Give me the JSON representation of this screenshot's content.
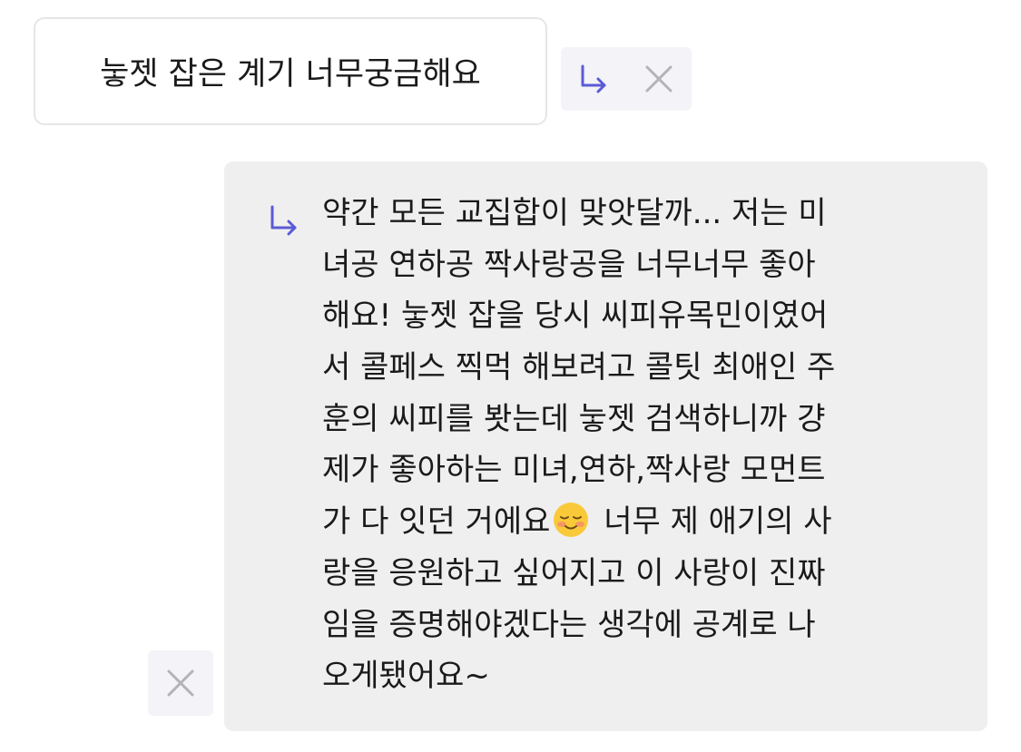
{
  "question": {
    "text": "눟젯 잡은 계기 너무궁금해요"
  },
  "question_actions": {
    "reply_icon": "reply-arrow-icon",
    "close_icon": "close-icon"
  },
  "answer": {
    "reply_icon": "reply-arrow-icon",
    "lines": [
      "약간 모든 교집합이 맞앗달까... 저는 미",
      "녀공 연하공 짝사랑공을 너무너무 좋아",
      "해요! 눟젯 잡을 당시 씨피유목민이였어",
      "서 콜페스 찍먹 해보려고 콜팃 최애인 주",
      "훈의 씨피를 봣는데 눟젯 검색하니까 걍",
      "제가 좋아하는 미녀,연하,짝사랑 모먼트",
      "",
      "랑을 응원하고 싶어지고 이 사랑이 진짜",
      "임을 증명해야겠다는 생각에 공계로 나",
      "오게됐어요~"
    ],
    "line7_before_emoji": "가 다 잇던 거에요",
    "line7_after_emoji": " 너무 제 애기의 사",
    "emoji": "smiling-face-emoji"
  },
  "bottom_actions": {
    "close_icon": "close-icon"
  },
  "colors": {
    "accent": "#5b5bd6",
    "icon_gray": "#b4b4b8",
    "bubble_gray": "#efefef",
    "action_bg": "#f3f3f8",
    "border": "#e6e6e6"
  }
}
